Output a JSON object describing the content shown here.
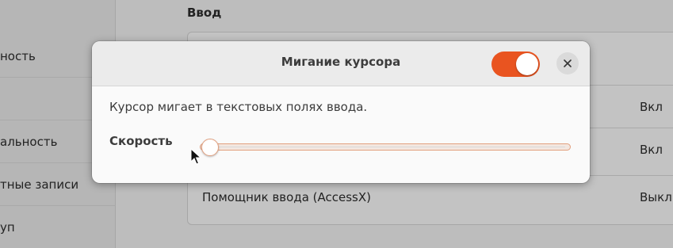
{
  "background": {
    "sidebar_items": [
      "ность",
      "",
      "альность",
      "тные записи",
      "уп"
    ],
    "section_title": "Ввод",
    "rows": [
      {
        "name": "",
        "value": "Вкл"
      },
      {
        "name": "",
        "value": "Вкл"
      },
      {
        "name": "Помощник ввода (AccessX)",
        "value": "Выкл"
      }
    ]
  },
  "dialog": {
    "title": "Мигание курсора",
    "toggle_on": true,
    "description": "Курсор мигает в текстовых полях ввода.",
    "speed_label": "Скорость",
    "speed_value": 0
  },
  "colors": {
    "accent": "#e95420"
  },
  "icons": {
    "close": "close-icon",
    "pointer": "mouse-pointer-icon"
  }
}
